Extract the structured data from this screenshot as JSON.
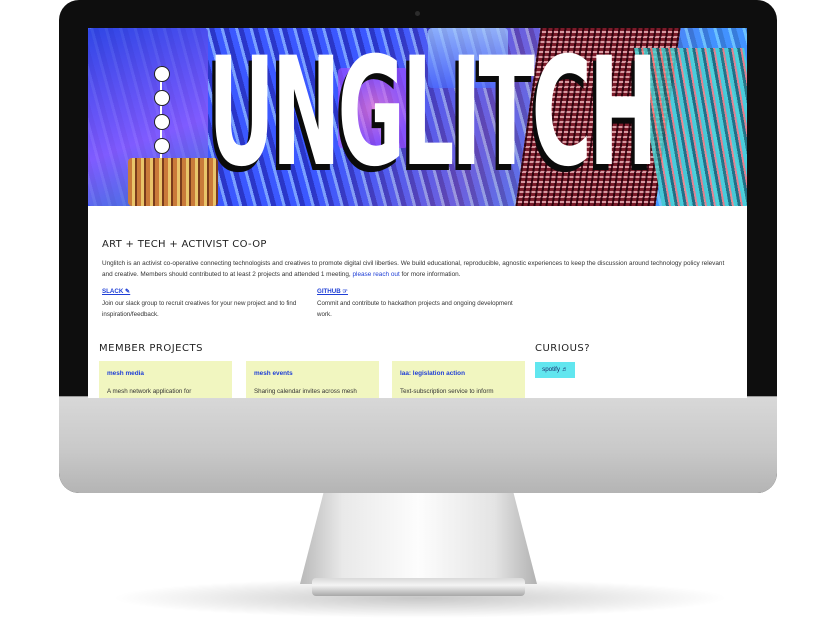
{
  "hero": {
    "title": "UNGLITCH"
  },
  "intro": {
    "tagline": "ART + TECH + ACTIVIST CO-OP",
    "description": "Unglitch is an activist co-operative connecting technologists and creatives to promote digital civil liberties. We build educational, reproducible, agnostic experiences to keep the discussion around technology policy relevant and creative. Members should contributed to at least 2 projects and attended 1 meeting,",
    "reach_out_link": "please reach out",
    "suffix": " for more information."
  },
  "links": [
    {
      "label": "SLACK ✎",
      "description": "Join our slack group to recruit creatives for your new project and to find inspiration/feedback."
    },
    {
      "label": "GITHUB ☞",
      "description": "Commit and contribute to hackathon projects and ongoing development work."
    }
  ],
  "projects": {
    "heading": "MEMBER PROJECTS",
    "cards": [
      {
        "title": "mesh media",
        "description": "A mesh network application for"
      },
      {
        "title": "mesh events",
        "description": "Sharing calendar invites across mesh"
      },
      {
        "title": "laa: legislation action",
        "description": "Text-subscription service to inform"
      }
    ]
  },
  "curious": {
    "heading": "CURIOUS?",
    "spotify_label": "spotify ♬"
  },
  "colors": {
    "link_blue": "#1f3fd6",
    "card_bg": "#f1f6c0",
    "accent_cyan": "#61e6ef"
  }
}
